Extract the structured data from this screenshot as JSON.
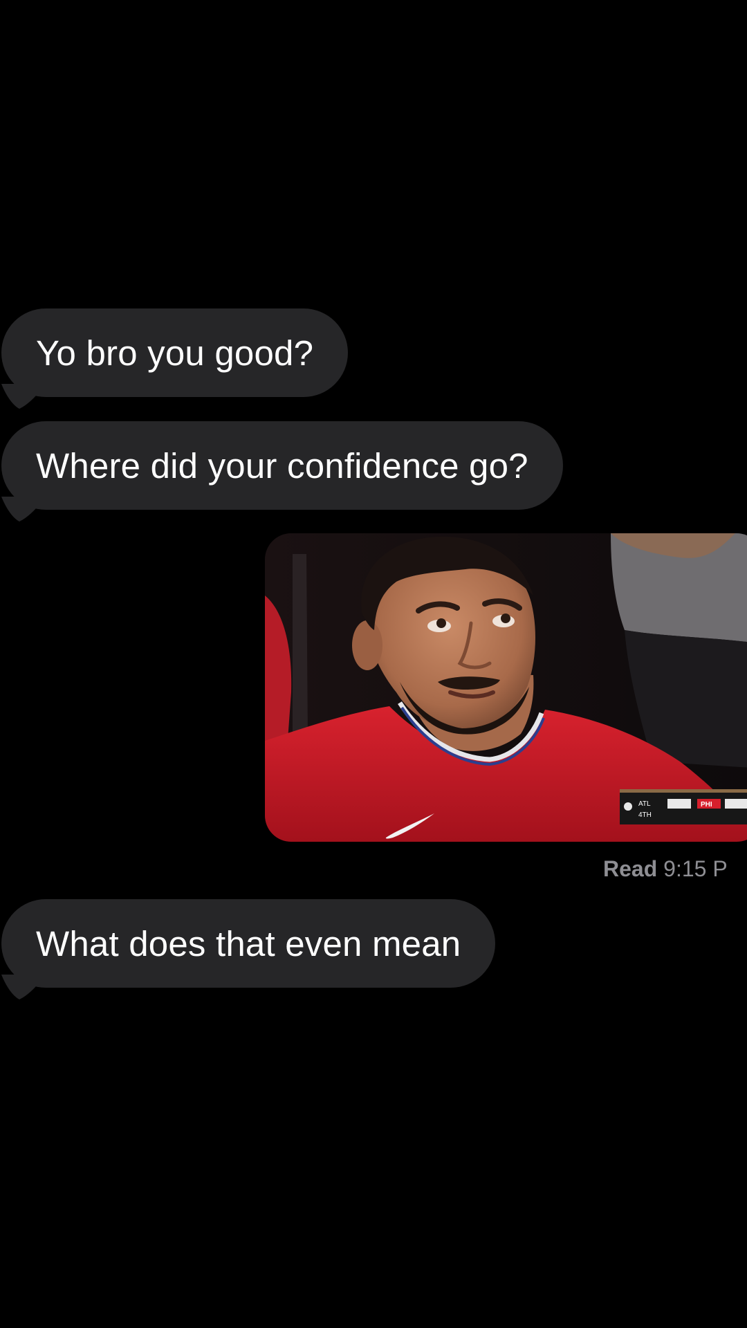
{
  "messages": [
    {
      "direction": "incoming",
      "text": "Yo bro you good?"
    },
    {
      "direction": "incoming",
      "text": "Where did your confidence go?"
    },
    {
      "direction": "outgoing",
      "type": "gif",
      "icon": "basketball-player-reaction-gif"
    },
    {
      "direction": "incoming",
      "text": "What does that even mean"
    }
  ],
  "gif_scorebug": {
    "team_1": "ATL",
    "period": "4TH",
    "team_2": "PHI"
  },
  "read_receipt": {
    "label": "Read",
    "time": "9:15 P"
  },
  "colors": {
    "background": "#000000",
    "incoming_bubble": "#262628",
    "text": "#ffffff",
    "receipt_text": "#8e8e93"
  }
}
